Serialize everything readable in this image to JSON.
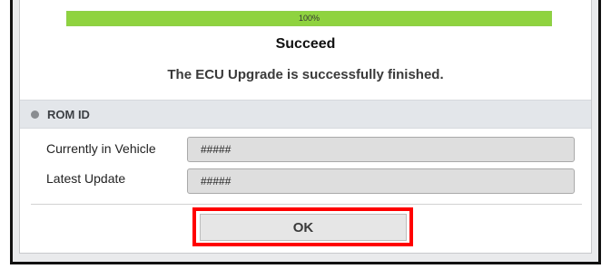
{
  "progress": {
    "percent_label": "100%",
    "fraction": 1.0,
    "color": "#8fd33f"
  },
  "dialog": {
    "title": "Succeed",
    "message": "The ECU Upgrade is successfully finished."
  },
  "rom_section": {
    "label": "ROM ID",
    "rows": [
      {
        "label": "Currently in Vehicle",
        "value": "#####"
      },
      {
        "label": "Latest Update",
        "value": "#####"
      }
    ]
  },
  "buttons": {
    "ok_label": "OK"
  },
  "annotation": {
    "highlight_color": "#ff0000"
  }
}
